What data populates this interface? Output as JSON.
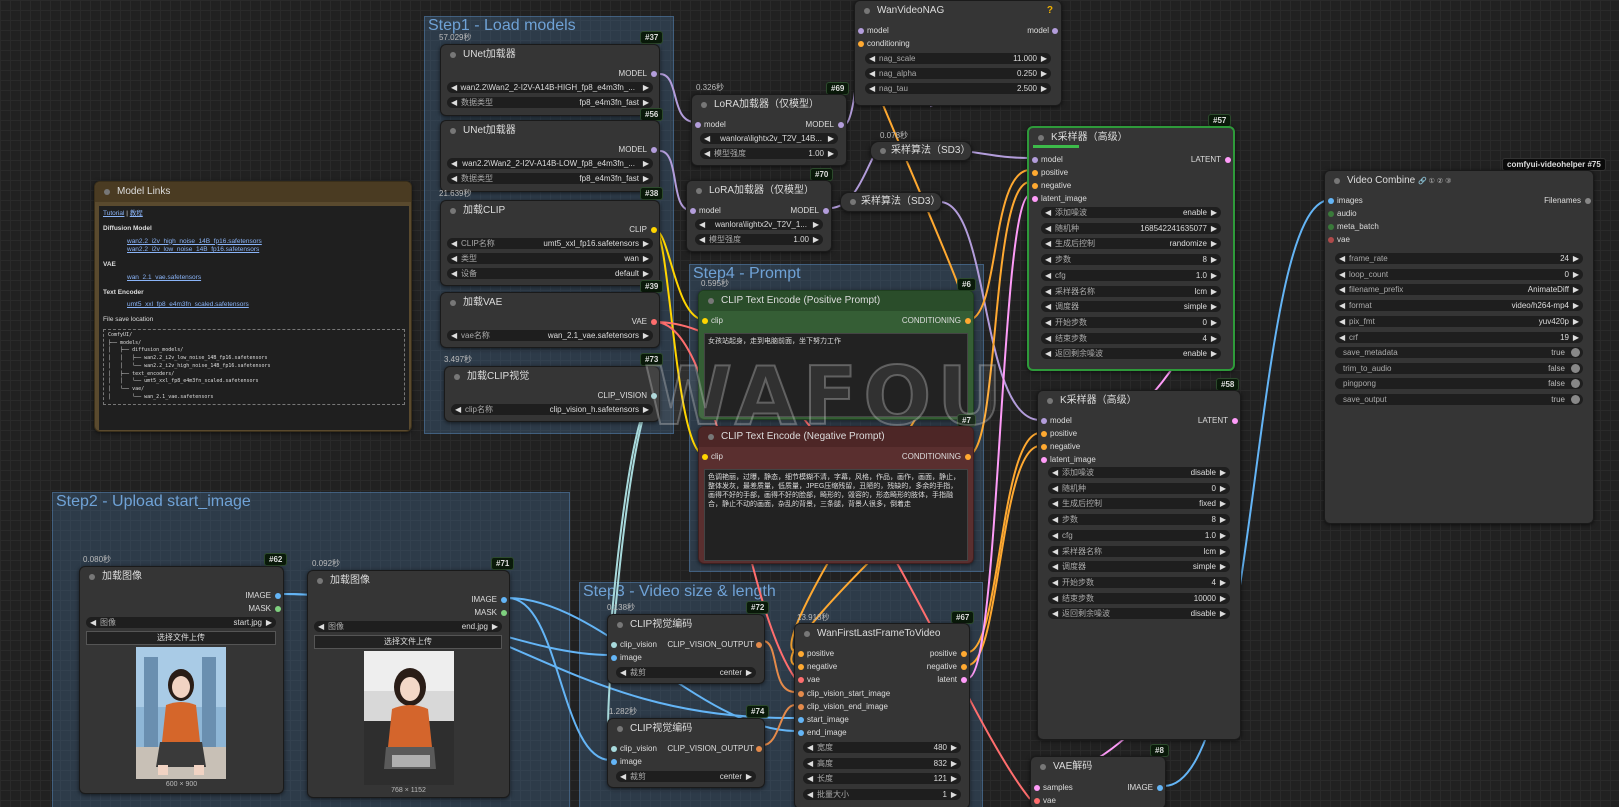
{
  "groups": {
    "step1": "Step1 - Load models",
    "step2": "Step2 - Upload start_image",
    "step3": "Step3 - Video size & length",
    "step4": "Step4 - Prompt"
  },
  "nag": {
    "title": "WanVideoNAG",
    "in_model": "model",
    "in_cond": "conditioning",
    "out_model": "model",
    "help": "?",
    "widgets": [
      {
        "label": "nag_scale",
        "value": "11.000"
      },
      {
        "label": "nag_alpha",
        "value": "0.250"
      },
      {
        "label": "nag_tau",
        "value": "2.500"
      }
    ]
  },
  "unet1": {
    "timing": "57.029秒",
    "badge": "#37",
    "title": "UNet加载器",
    "out": "MODEL",
    "widgets": [
      {
        "label": "",
        "value": "wan2.2\\Wan2_2-I2V-A14B-HIGH_fp8_e4m3fn_..."
      },
      {
        "label": "数据类型",
        "value": "fp8_e4m3fn_fast"
      }
    ]
  },
  "unet2": {
    "badge": "#56",
    "title": "UNet加载器",
    "out": "MODEL",
    "widgets": [
      {
        "label": "",
        "value": "wan2.2\\Wan2_2-I2V-A14B-LOW_fp8_e4m3fn_..."
      },
      {
        "label": "数据类型",
        "value": "fp8_e4m3fn_fast"
      }
    ]
  },
  "clip_loader": {
    "timing": "21.639秒",
    "badge": "#38",
    "title": "加载CLIP",
    "out": "CLIP",
    "widgets": [
      {
        "label": "CLIP名称",
        "value": "umt5_xxl_fp16.safetensors"
      },
      {
        "label": "类型",
        "value": "wan"
      },
      {
        "label": "设备",
        "value": "default"
      }
    ]
  },
  "vae_loader": {
    "badge": "#39",
    "title": "加载VAE",
    "out": "VAE",
    "widgets": [
      {
        "label": "vae名称",
        "value": "wan_2.1_vae.safetensors"
      }
    ]
  },
  "clipvision_loader": {
    "timing": "3.497秒",
    "badge": "#73",
    "title": "加载CLIP视觉",
    "out": "CLIP_VISION",
    "widgets": [
      {
        "label": "clip名称",
        "value": "clip_vision_h.safetensors"
      }
    ]
  },
  "lora1": {
    "timing": "0.326秒",
    "badge": "#69",
    "title": "LoRA加载器（仅模型）",
    "in": "model",
    "out": "MODEL",
    "widgets": [
      {
        "label": "",
        "value": "wanlora\\lightx2v_T2V_14B..."
      },
      {
        "label": "模型强度",
        "value": "1.00"
      }
    ]
  },
  "lora2": {
    "badge": "#70",
    "title": "LoRA加载器（仅模型）",
    "in": "model",
    "out": "MODEL",
    "widgets": [
      {
        "label": "",
        "value": "wanlora\\lightx2v_T2V_1..."
      },
      {
        "label": "模型强度",
        "value": "1.00"
      }
    ]
  },
  "sampling1": {
    "timing": "0.078秒",
    "title": "采样算法（SD3）"
  },
  "sampling2": {
    "title": "采样算法（SD3）"
  },
  "ks1": {
    "badge": "#57",
    "title": "K采样器（高级）",
    "out": "LATENT",
    "inputs": [
      "model",
      "positive",
      "negative",
      "latent_image"
    ],
    "widgets": [
      {
        "label": "添加噪波",
        "value": "enable"
      },
      {
        "label": "随机种",
        "value": "168542241635077"
      },
      {
        "label": "生成后控制",
        "value": "randomize"
      },
      {
        "label": "步数",
        "value": "8"
      },
      {
        "label": "cfg",
        "value": "1.0"
      },
      {
        "label": "采样器名称",
        "value": "lcm"
      },
      {
        "label": "调度器",
        "value": "simple"
      },
      {
        "label": "开始步数",
        "value": "0"
      },
      {
        "label": "结束步数",
        "value": "4"
      },
      {
        "label": "返回剩余噪波",
        "value": "enable"
      }
    ]
  },
  "ks2": {
    "badge": "#58",
    "title": "K采样器（高级）",
    "out": "LATENT",
    "inputs": [
      "model",
      "positive",
      "negative",
      "latent_image"
    ],
    "widgets": [
      {
        "label": "添加噪波",
        "value": "disable"
      },
      {
        "label": "随机种",
        "value": "0"
      },
      {
        "label": "生成后控制",
        "value": "fixed"
      },
      {
        "label": "步数",
        "value": "8"
      },
      {
        "label": "cfg",
        "value": "1.0"
      },
      {
        "label": "采样器名称",
        "value": "lcm"
      },
      {
        "label": "调度器",
        "value": "simple"
      },
      {
        "label": "开始步数",
        "value": "4"
      },
      {
        "label": "结束步数",
        "value": "10000"
      },
      {
        "label": "返回剩余噪波",
        "value": "disable"
      }
    ]
  },
  "vc": {
    "badge": "comfyui-videohelper",
    "badge_id": "#75",
    "title": "Video Combine",
    "title_icons": "🔗 ① ② ③",
    "inputs": [
      "images",
      "audio",
      "meta_batch",
      "vae"
    ],
    "out": "Filenames",
    "widgets": [
      {
        "label": "frame_rate",
        "value": "24"
      },
      {
        "label": "loop_count",
        "value": "0"
      },
      {
        "label": "filename_prefix",
        "value": "AnimateDiff"
      },
      {
        "label": "format",
        "value": "video/h264-mp4"
      },
      {
        "label": "pix_fmt",
        "value": "yuv420p"
      },
      {
        "label": "crf",
        "value": "19"
      }
    ],
    "toggles": [
      {
        "label": "save_metadata",
        "value": "true"
      },
      {
        "label": "trim_to_audio",
        "value": "false"
      },
      {
        "label": "pingpong",
        "value": "false"
      },
      {
        "label": "save_output",
        "value": "true"
      }
    ]
  },
  "links": {
    "title": "Model Links",
    "tutorial": "Tutorial",
    "sep": "|",
    "tutorial_cn": "教程",
    "dm_head": "Diffusion Model",
    "dm1": "wan2.2_i2v_high_noise_14B_fp16.safetensors",
    "dm2": "wan2.2_i2v_low_noise_14B_fp16.safetensors",
    "vae_head": "VAE",
    "vae1": "wan_2.1_vae.safetensors",
    "te_head": "Text Encoder",
    "te1": "umt5_xxl_fp8_e4m3fn_scaled.safetensors",
    "save_head": "File save location",
    "tree": [
      "ComfyUI/",
      "├── models/",
      "│   ├── diffusion_models/",
      "│   │   ├── wan2.2_i2v_low_noise_14B_fp16.safetensors",
      "│   │   └── wan2.2_i2v_high_noise_14B_fp16.safetensors",
      "│   ├── text_encoders/",
      "│   │   └── umt5_xxl_fp8_e4m3fn_scaled.safetensors",
      "│   └── vae/",
      "│       └── wan_2.1_vae.safetensors"
    ]
  },
  "pos": {
    "timing": "0.595秒",
    "badge": "#6",
    "title": "CLIP Text Encode (Positive Prompt)",
    "in": "clip",
    "out": "CONDITIONING",
    "text": "女孩站起身，走到电脑前面，坐下努力工作"
  },
  "neg": {
    "badge": "#7",
    "title": "CLIP Text Encode (Negative Prompt)",
    "in": "clip",
    "out": "CONDITIONING",
    "text": "色调艳丽，过曝，静态，细节模糊不清，字幕，风格，作品，画作，画面，静止，整体发灰，最差质量，低质量，JPEG压缩残留，丑陋的，残缺的，多余的手指，画得不好的手部，画得不好的脸部，畸形的，毁容的，形态畸形的肢体，手指融合，静止不动的画面，杂乱的背景，三条腿，背景人很多，倒着走"
  },
  "img1": {
    "timing": "0.080秒",
    "badge": "#62",
    "title": "加载图像",
    "out1": "IMAGE",
    "out2": "MASK",
    "widget_label": "图像",
    "widget_value": "start.jpg",
    "upload": "选择文件上传",
    "size": "600 × 900"
  },
  "img2": {
    "timing": "0.092秒",
    "badge": "#71",
    "title": "加载图像",
    "out1": "IMAGE",
    "out2": "MASK",
    "widget_label": "图像",
    "widget_value": "end.jpg",
    "upload": "选择文件上传",
    "size": "768 × 1152"
  },
  "cve1": {
    "timing": "0.138秒",
    "badge": "#72",
    "title": "CLIP视觉编码",
    "in1": "clip_vision",
    "in2": "image",
    "out": "CLIP_VISION_OUTPUT",
    "widget_label": "裁剪",
    "widget_value": "center"
  },
  "cve2": {
    "timing": "1.282秒",
    "badge": "#74",
    "title": "CLIP视觉编码",
    "in1": "clip_vision",
    "in2": "image",
    "out": "CLIP_VISION_OUTPUT",
    "widget_label": "裁剪",
    "widget_value": "center"
  },
  "wflf": {
    "timing": "13.918秒",
    "badge": "#67",
    "title": "WanFirstLastFrameToVideo",
    "inputs": [
      "positive",
      "negative",
      "vae",
      "clip_vision_start_image",
      "clip_vision_end_image",
      "start_image",
      "end_image"
    ],
    "outputs": [
      "positive",
      "negative",
      "latent"
    ],
    "widgets": [
      {
        "label": "宽度",
        "value": "480"
      },
      {
        "label": "高度",
        "value": "832"
      },
      {
        "label": "长度",
        "value": "121"
      },
      {
        "label": "批量大小",
        "value": "1"
      }
    ]
  },
  "vaedec": {
    "badge": "#8",
    "title": "VAE解码",
    "in1": "samples",
    "in2": "vae",
    "out": "IMAGE"
  },
  "watermark": "WAFOU",
  "colors": {
    "model": "#b39ddb",
    "clip": "#ffd500",
    "vae": "#ff6e6e",
    "cond": "#ffa931",
    "latent": "#ff9cf9",
    "image": "#64b5f6",
    "clipvision": "#a8dadc"
  }
}
